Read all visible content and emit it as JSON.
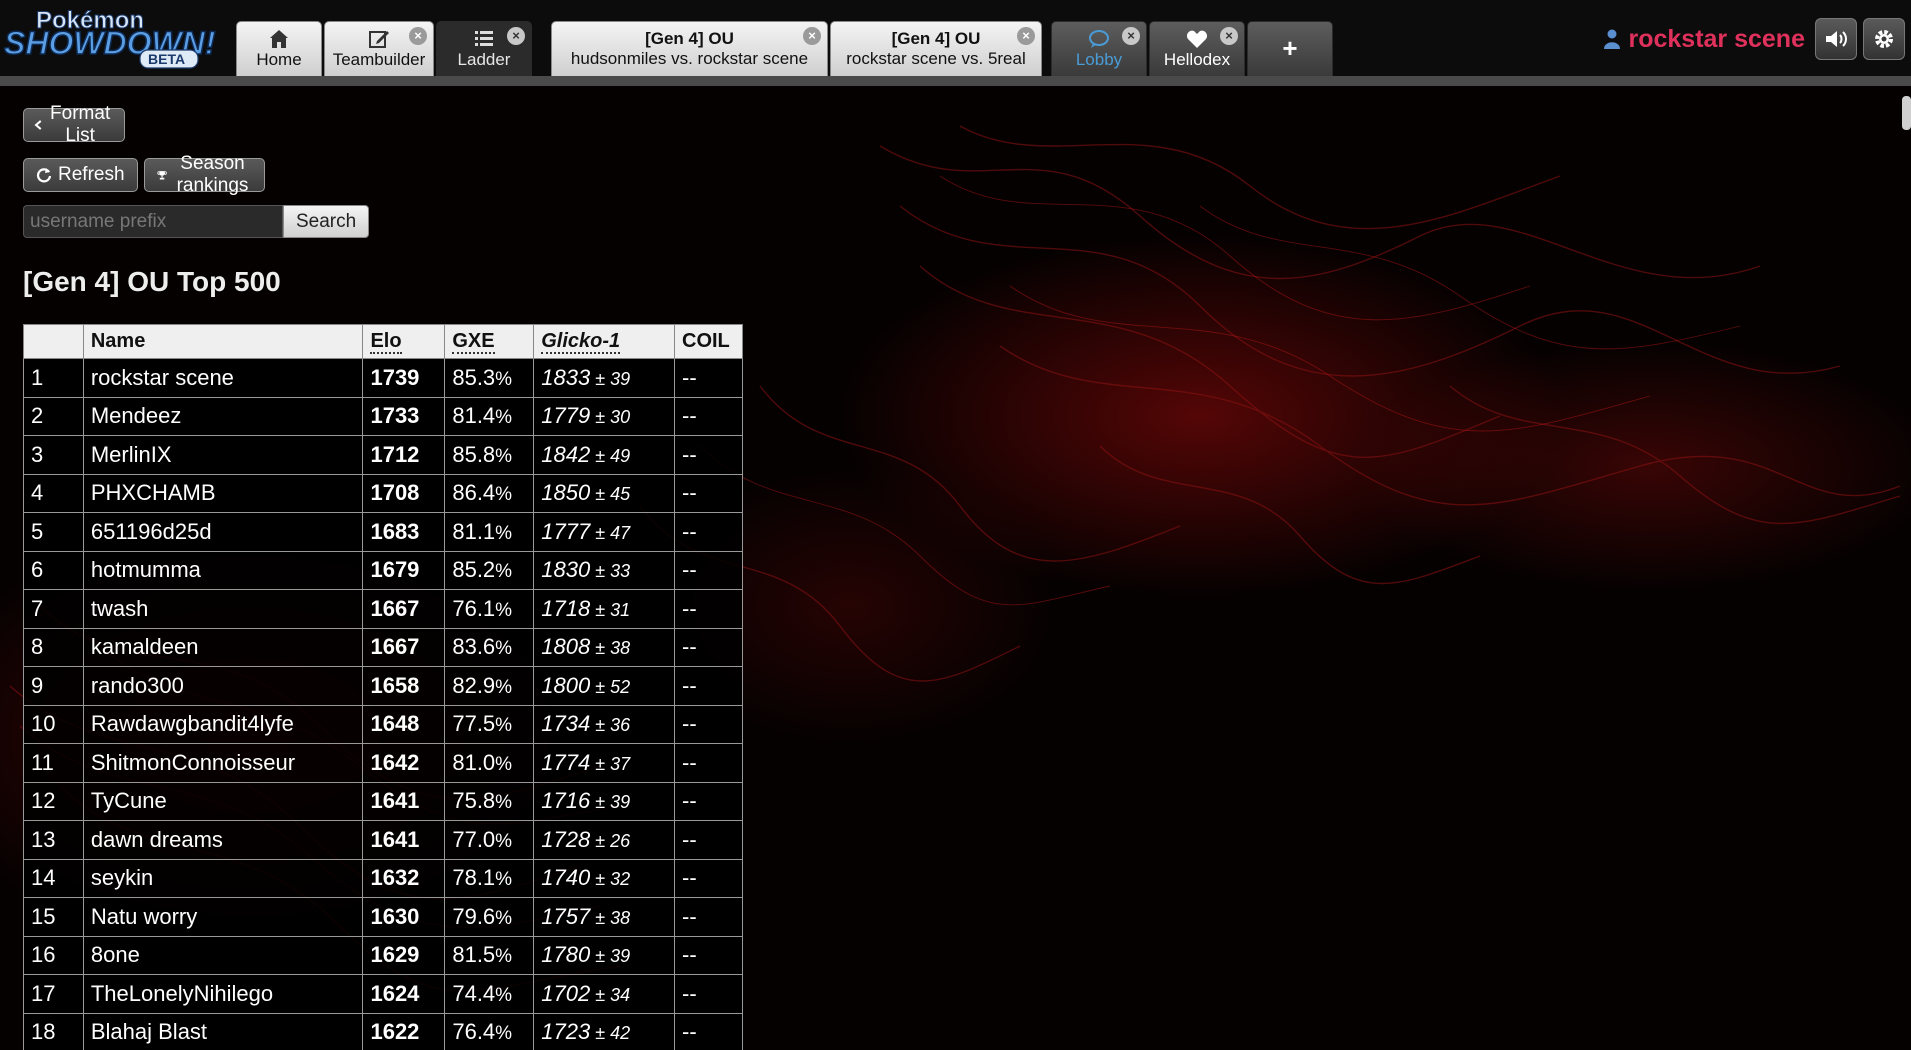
{
  "header": {
    "logo": {
      "top": "Pokémon",
      "main": "SHOWDOWN!",
      "badge": "BETA"
    },
    "tabs_main": [
      {
        "label": "Home",
        "icon": "home-icon"
      },
      {
        "label": "Teambuilder",
        "icon": "edit-icon"
      },
      {
        "label": "Ladder",
        "icon": "list-icon"
      }
    ],
    "tabs_battles": [
      {
        "title": "[Gen 4] OU",
        "subtitle": "hudsonmiles vs. rockstar scene"
      },
      {
        "title": "[Gen 4] OU",
        "subtitle": "rockstar scene vs. 5real"
      }
    ],
    "tabs_rooms": [
      {
        "label": "Lobby",
        "icon": "chat-icon"
      },
      {
        "label": "Hellodex",
        "icon": "heart-icon"
      }
    ],
    "new_tab_label": "+",
    "username": "rockstar scene"
  },
  "ladder": {
    "format_list_label": "Format List",
    "refresh_label": "Refresh",
    "season_label": "Season rankings",
    "search_placeholder": "username prefix",
    "search_button": "Search",
    "title": "[Gen 4] OU Top 500",
    "columns": [
      "",
      "Name",
      "Elo",
      "GXE",
      "Glicko-1",
      "COIL"
    ],
    "rows": [
      {
        "rank": "1",
        "name": "rockstar scene",
        "elo": "1739",
        "gxe": "85.3",
        "glicko": "1833",
        "dev": "39",
        "coil": "--"
      },
      {
        "rank": "2",
        "name": "Mendeez",
        "elo": "1733",
        "gxe": "81.4",
        "glicko": "1779",
        "dev": "30",
        "coil": "--"
      },
      {
        "rank": "3",
        "name": "MerlinIX",
        "elo": "1712",
        "gxe": "85.8",
        "glicko": "1842",
        "dev": "49",
        "coil": "--"
      },
      {
        "rank": "4",
        "name": "PHXCHAMB",
        "elo": "1708",
        "gxe": "86.4",
        "glicko": "1850",
        "dev": "45",
        "coil": "--"
      },
      {
        "rank": "5",
        "name": "651196d25d",
        "elo": "1683",
        "gxe": "81.1",
        "glicko": "1777",
        "dev": "47",
        "coil": "--"
      },
      {
        "rank": "6",
        "name": "hotmumma",
        "elo": "1679",
        "gxe": "85.2",
        "glicko": "1830",
        "dev": "33",
        "coil": "--"
      },
      {
        "rank": "7",
        "name": "twash",
        "elo": "1667",
        "gxe": "76.1",
        "glicko": "1718",
        "dev": "31",
        "coil": "--"
      },
      {
        "rank": "8",
        "name": "kamaldeen",
        "elo": "1667",
        "gxe": "83.6",
        "glicko": "1808",
        "dev": "38",
        "coil": "--"
      },
      {
        "rank": "9",
        "name": "rando300",
        "elo": "1658",
        "gxe": "82.9",
        "glicko": "1800",
        "dev": "52",
        "coil": "--"
      },
      {
        "rank": "10",
        "name": "Rawdawgbandit4lyfe",
        "elo": "1648",
        "gxe": "77.5",
        "glicko": "1734",
        "dev": "36",
        "coil": "--"
      },
      {
        "rank": "11",
        "name": "ShitmonConnoisseur",
        "elo": "1642",
        "gxe": "81.0",
        "glicko": "1774",
        "dev": "37",
        "coil": "--"
      },
      {
        "rank": "12",
        "name": "TyCune",
        "elo": "1641",
        "gxe": "75.8",
        "glicko": "1716",
        "dev": "39",
        "coil": "--"
      },
      {
        "rank": "13",
        "name": "dawn dreams",
        "elo": "1641",
        "gxe": "77.0",
        "glicko": "1728",
        "dev": "26",
        "coil": "--"
      },
      {
        "rank": "14",
        "name": "seykin",
        "elo": "1632",
        "gxe": "78.1",
        "glicko": "1740",
        "dev": "32",
        "coil": "--"
      },
      {
        "rank": "15",
        "name": "Natu worry",
        "elo": "1630",
        "gxe": "79.6",
        "glicko": "1757",
        "dev": "38",
        "coil": "--"
      },
      {
        "rank": "16",
        "name": "8one",
        "elo": "1629",
        "gxe": "81.5",
        "glicko": "1780",
        "dev": "39",
        "coil": "--"
      },
      {
        "rank": "17",
        "name": "TheLonelyNihilego",
        "elo": "1624",
        "gxe": "74.4",
        "glicko": "1702",
        "dev": "34",
        "coil": "--"
      },
      {
        "rank": "18",
        "name": "Blahaj Blast",
        "elo": "1622",
        "gxe": "76.4",
        "glicko": "1723",
        "dev": "42",
        "coil": "--"
      }
    ]
  },
  "colors": {
    "accent_username": "#e0305c",
    "lobby_blue": "#4a9bd6",
    "header_bg": "#0c0c0c"
  }
}
